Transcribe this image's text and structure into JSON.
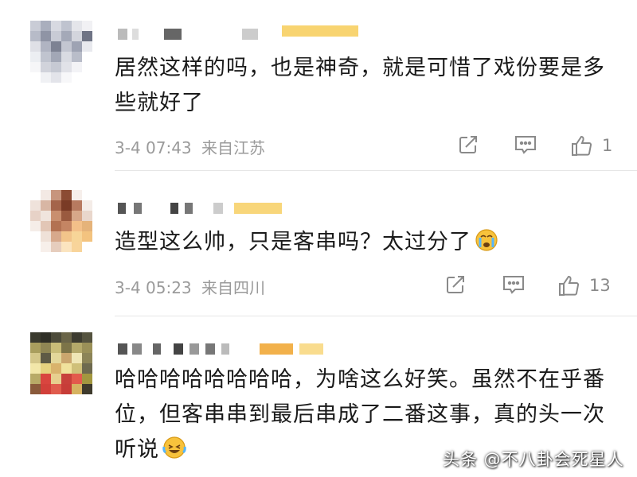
{
  "comments": [
    {
      "text": "居然这样的吗，也是神奇，就是可惜了戏份要是多些就好了",
      "time": "3-4 07:43",
      "location": "来自江苏",
      "like_count": "1",
      "icons": {
        "share": "share-icon",
        "comment": "comment-icon",
        "like": "thumbs-up-icon"
      }
    },
    {
      "text": "造型这么帅，只是客串吗？太过分了",
      "emoji": "crying-face-emoji",
      "time": "3-4 05:23",
      "location": "来自四川",
      "like_count": "13",
      "icons": {
        "share": "share-icon",
        "comment": "comment-icon",
        "like": "thumbs-up-icon"
      }
    },
    {
      "text": "哈哈哈哈哈哈哈哈，为啥这么好笑。虽然不在乎番位，但客串串到最后串成了二番这事，真的头一次听说",
      "emoji": "laughing-tears-emoji"
    }
  ],
  "watermark": "头条 @不八卦会死星人",
  "colors": {
    "text": "#1a1a1a",
    "meta": "#9a9a9a",
    "icon": "#8a8a8a",
    "username_badge": "#f5c542"
  }
}
